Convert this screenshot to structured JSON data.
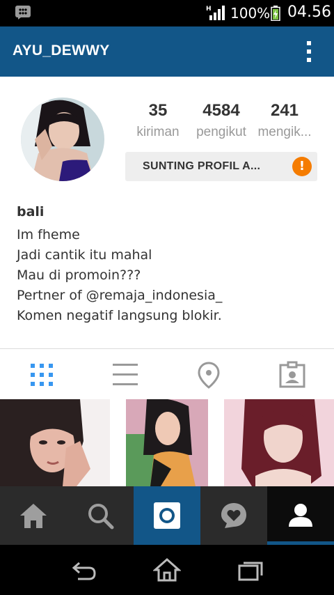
{
  "status_bar": {
    "network": "H",
    "battery_percent": "100%",
    "time": "04.56",
    "icons": [
      "bbm-icon",
      "signal-icon",
      "battery-charging-icon"
    ]
  },
  "header": {
    "username": "AYU_DEWWY",
    "menu_icon": "overflow-menu-icon"
  },
  "profile": {
    "stats": [
      {
        "value": "35",
        "label": "kiriman"
      },
      {
        "value": "4584",
        "label": "pengikut"
      },
      {
        "value": "241",
        "label": "mengik..."
      }
    ],
    "edit_button_label": "SUNTING PROFIL A...",
    "warning_glyph": "!",
    "bio": {
      "name": "bali",
      "lines": [
        "Im fheme",
        "Jadi cantik itu mahal",
        "Mau di promoin???",
        "Pertner of @remaja_indonesia_",
        "Komen negatif langsung blokir."
      ]
    }
  },
  "tabs": [
    {
      "name": "grid-view-icon",
      "active": true
    },
    {
      "name": "list-view-icon",
      "active": false
    },
    {
      "name": "map-pin-icon",
      "active": false
    },
    {
      "name": "tagged-photos-icon",
      "active": false
    }
  ],
  "bottom_nav": [
    {
      "name": "home-icon"
    },
    {
      "name": "search-icon"
    },
    {
      "name": "camera-icon"
    },
    {
      "name": "activity-heart-icon"
    },
    {
      "name": "profile-icon",
      "active": true
    }
  ],
  "system_nav": [
    "back-icon",
    "home-icon",
    "recent-apps-icon"
  ],
  "colors": {
    "brand_blue": "#125688",
    "tab_active": "#3897f0",
    "warning": "#f57c00"
  }
}
